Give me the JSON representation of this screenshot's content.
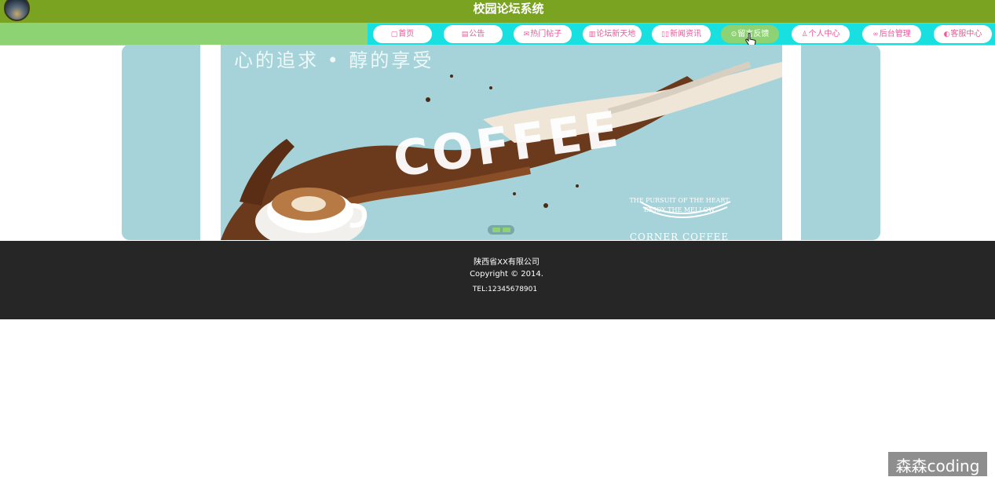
{
  "header": {
    "title": "校园论坛系统",
    "logo_icon": "logo-image"
  },
  "nav": {
    "items": [
      {
        "label": "首页",
        "icon": "home-icon",
        "glyph": "▢",
        "active": false
      },
      {
        "label": "公告",
        "icon": "notice-icon",
        "glyph": "▤",
        "active": false
      },
      {
        "label": "热门帖子",
        "icon": "mail-icon",
        "glyph": "✉",
        "active": false
      },
      {
        "label": "论坛新天地",
        "icon": "forum-icon",
        "glyph": "▥",
        "active": false
      },
      {
        "label": "新闻资讯",
        "icon": "news-icon",
        "glyph": "▯▯",
        "active": false
      },
      {
        "label": "留言反馈",
        "icon": "feedback-icon",
        "glyph": "⊙",
        "active": true
      },
      {
        "label": "个人中心",
        "icon": "user-icon",
        "glyph": "♙",
        "active": false
      },
      {
        "label": "后台管理",
        "icon": "link-icon",
        "glyph": "∞",
        "active": false
      },
      {
        "label": "客服中心",
        "icon": "service-icon",
        "glyph": "◐",
        "active": false
      }
    ]
  },
  "banner": {
    "slogan": "心的追求 • 醇的享受",
    "word": "COFFEE",
    "pursuit_line1": "THE PURSUIT OF THE HEART",
    "pursuit_line2": "ENJOY THE MELLOW",
    "brand": "CORNER COFFEE"
  },
  "footer": {
    "company": "陕西省XX有限公司",
    "copyright": "Copyright © 2014.",
    "tel": "TEL:12345678901"
  },
  "watermark": {
    "text": "森森coding"
  },
  "colors": {
    "topbar": "#7aa321",
    "navband": "#8dd373",
    "navcyan": "#19e0e0",
    "nav_text": "#e85a9a",
    "banner_bg": "#a6d3d9",
    "footer_bg": "#262626"
  }
}
